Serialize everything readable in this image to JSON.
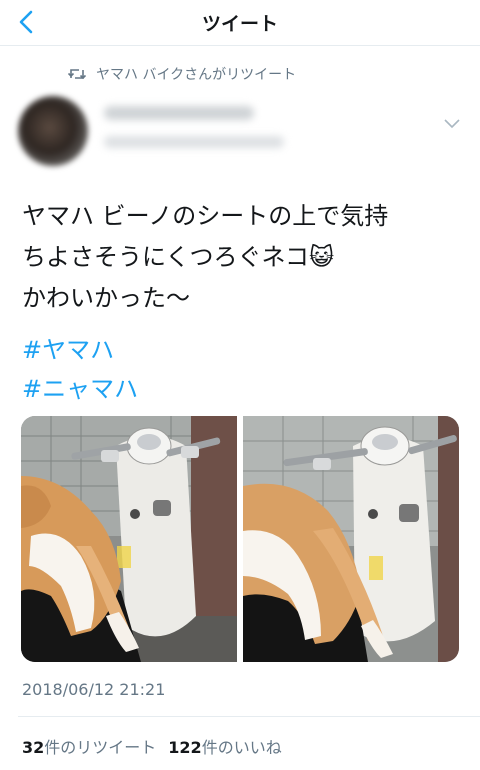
{
  "header": {
    "title": "ツイート"
  },
  "retweet_line": {
    "text": "ヤマハ バイクさんがリツイート"
  },
  "tweet": {
    "lines": [
      "ヤマハ ビーノのシートの上で気持",
      "ちよさそうにくつろぐネコ😺",
      "かわいかった〜"
    ],
    "hashtags": [
      "#ヤマハ",
      "#ニャマハ"
    ],
    "timestamp": "2018/06/12 21:21"
  },
  "stats": {
    "retweets_count": "32",
    "retweets_label": "件のリツイート",
    "likes_count": "122",
    "likes_label": "件のいいね"
  },
  "icons": {
    "back": "chevron-left-icon",
    "retweet": "retweet-icon",
    "more": "chevron-down-icon"
  },
  "colors": {
    "accent": "#1da1f2",
    "secondary_text": "#657786",
    "primary_text": "#14171a",
    "divider": "#e6ecf0"
  }
}
